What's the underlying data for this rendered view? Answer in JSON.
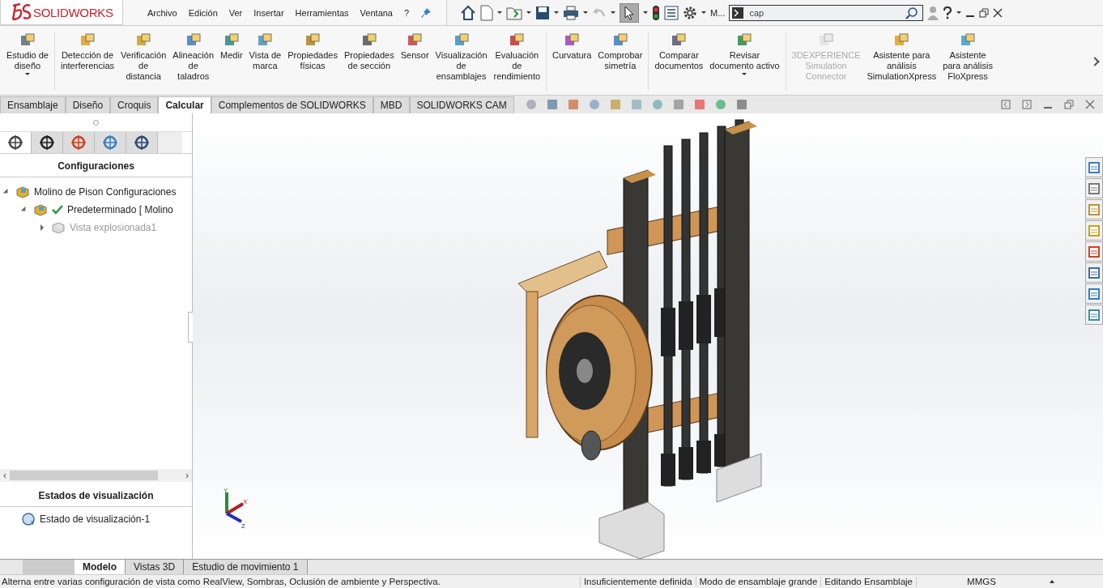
{
  "app": {
    "logo": "**SOLID**WORKS"
  },
  "menu": [
    "Archivo",
    "Edición",
    "Ver",
    "Insertar",
    "Herramientas",
    "Ventana",
    "?"
  ],
  "quick_toolbar": {
    "overflow": "M...",
    "search": {
      "value": "cap"
    }
  },
  "ribbon": [
    {
      "label": "Estudio de\ndiseño",
      "disabled": false,
      "dropdown": true
    },
    {
      "label": "Detección de\ninterferencias",
      "disabled": false,
      "dropdown": false
    },
    {
      "label": "Verificación\nde\ndistancia",
      "disabled": false,
      "dropdown": false
    },
    {
      "label": "Alineación\nde\ntaladros",
      "disabled": false,
      "dropdown": false
    },
    {
      "label": "Medir",
      "disabled": false,
      "dropdown": false
    },
    {
      "label": "Vista de\nmarca",
      "disabled": false,
      "dropdown": false
    },
    {
      "label": "Propiedades\nfísicas",
      "disabled": false,
      "dropdown": false
    },
    {
      "label": "Propiedades\nde sección",
      "disabled": false,
      "dropdown": false
    },
    {
      "label": "Sensor",
      "disabled": false,
      "dropdown": false
    },
    {
      "label": "Visualización\nde\nensamblajes",
      "disabled": false,
      "dropdown": false
    },
    {
      "label": "Evaluación\nde\nrendimiento",
      "disabled": false,
      "dropdown": false
    },
    {
      "label": "Curvatura",
      "disabled": false,
      "dropdown": false
    },
    {
      "label": "Comprobar\nsimetría",
      "disabled": false,
      "dropdown": false
    },
    {
      "label": "Comparar\ndocumentos",
      "disabled": false,
      "dropdown": false
    },
    {
      "label": "Revisar\ndocumento activo",
      "disabled": false,
      "dropdown": true
    },
    {
      "label": "3DEXPERIENCE\nSimulation\nConnector",
      "disabled": true,
      "dropdown": false
    },
    {
      "label": "Asistente para\nanálisis\nSimulationXpress",
      "disabled": false,
      "dropdown": false
    },
    {
      "label": "Asistente\npara análisis\nFloXpress",
      "disabled": false,
      "dropdown": false
    }
  ],
  "command_tabs": [
    {
      "label": "Ensamblaje",
      "selected": false
    },
    {
      "label": "Diseño",
      "selected": false
    },
    {
      "label": "Croquis",
      "selected": false
    },
    {
      "label": "Calcular",
      "selected": true
    },
    {
      "label": "Complementos de SOLIDWORKS",
      "selected": false
    },
    {
      "label": "MBD",
      "selected": false
    },
    {
      "label": "SOLIDWORKS CAM",
      "selected": false
    }
  ],
  "panel_tabs": [
    {
      "selected": true
    },
    {
      "selected": false
    },
    {
      "selected": false
    },
    {
      "selected": false
    },
    {
      "selected": false
    }
  ],
  "configurations": {
    "title": "Configuraciones",
    "tree": [
      {
        "label": "Molino de Pison Configuraciones",
        "expanded": true,
        "children": [
          {
            "label": "Predeterminado [ Molino",
            "expanded": true,
            "active": true,
            "children": [
              {
                "label": "Vista explosionada1",
                "expanded": false,
                "disabled": true
              }
            ]
          }
        ]
      }
    ]
  },
  "triad": {
    "labels": [
      "Y",
      "X",
      "Z"
    ]
  },
  "panel_scroll": {
    "left": "‹",
    "right": "›"
  },
  "display_states": {
    "title": "Estados de visualización",
    "items": [
      "Estado de visualización-1"
    ]
  },
  "bottom_tabs": [
    {
      "label": "Modelo",
      "selected": true
    },
    {
      "label": "Vistas 3D",
      "selected": false
    },
    {
      "label": "Estudio de movimiento 1",
      "selected": false
    }
  ],
  "status_bar": {
    "message": "Alterna entre varias configuración de vista como RealView, Sombras, Oclusión de ambiente y Perspectiva.",
    "fields": [
      "Insuficientemente definida",
      "Modo de ensamblaje grande",
      "Editando Ensamblaje"
    ],
    "units": "MMGS"
  }
}
